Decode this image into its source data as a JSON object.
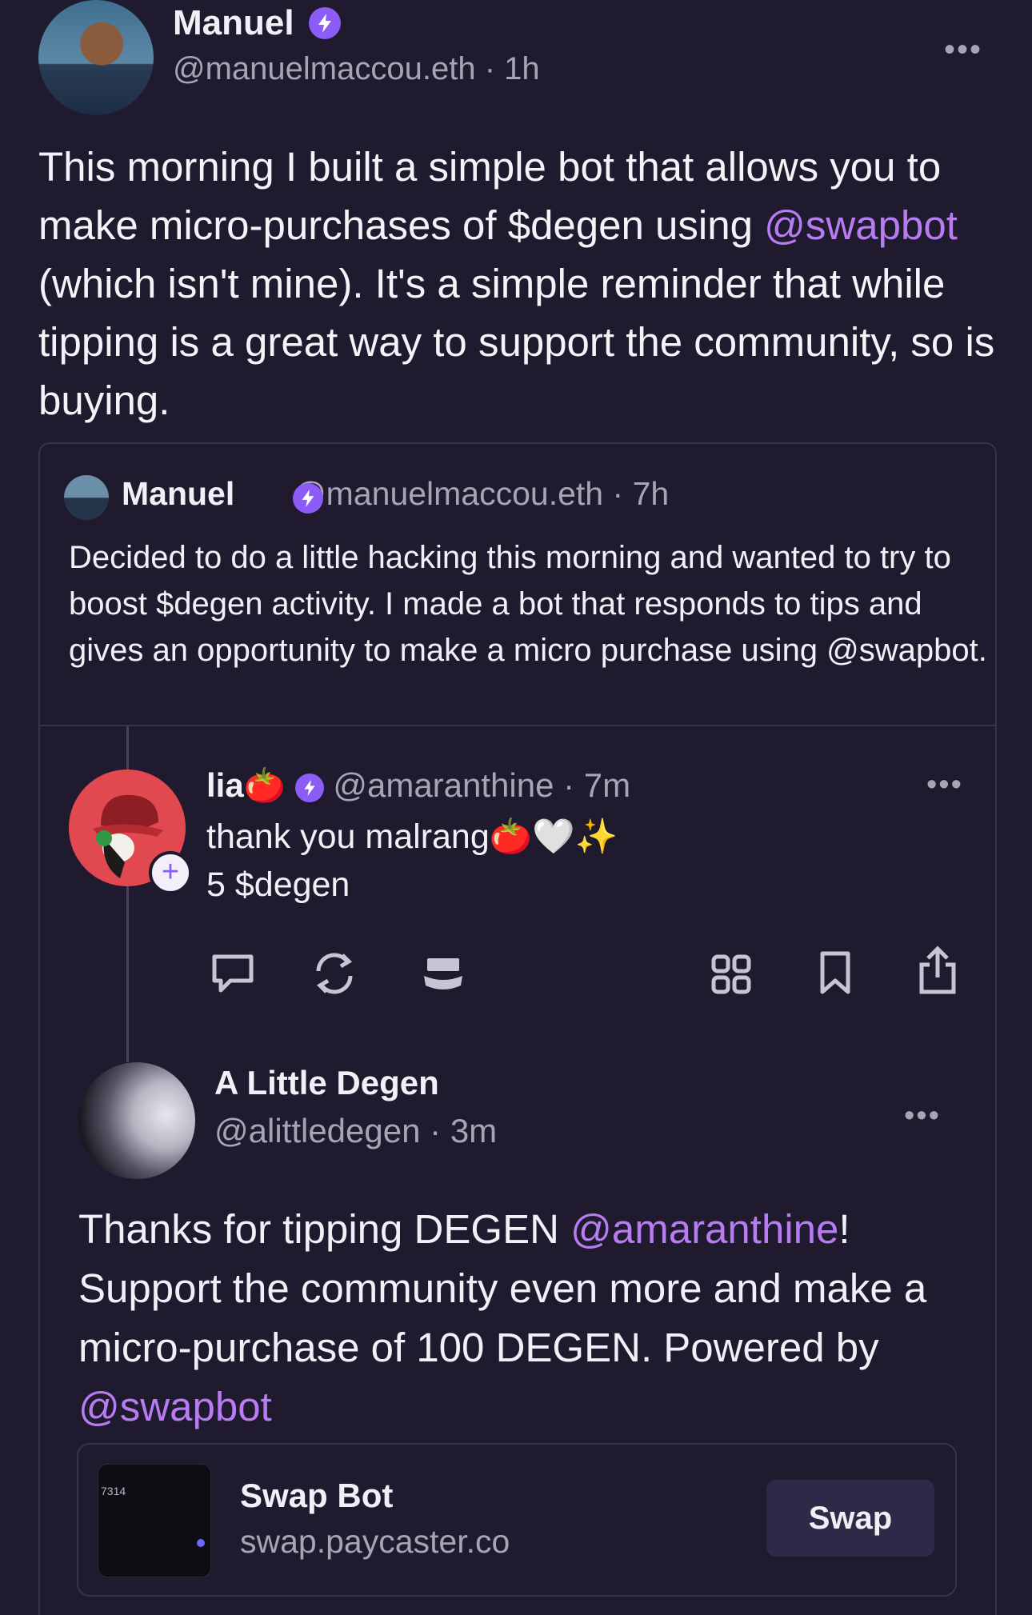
{
  "post": {
    "author_name": "Manuel",
    "author_handle": "@manuelmaccou.eth",
    "time": "1h",
    "more_icon": "ellipsis-icon",
    "body": {
      "part1": "This morning I built a simple bot that allows you to make micro-purchases of $degen using ",
      "mention": "@swapbot",
      "part2": " (which isn't mine). It's a simple reminder that while tipping is a great way to support the community, so is buying."
    }
  },
  "quote": {
    "author_name": "Manuel",
    "author_handle": "@manuelmaccou.eth",
    "time": "7h",
    "body": "Decided to do a little hacking this morning and wanted to try to boost $degen activity. I made a bot that responds to tips and gives an opportunity to make a micro purchase using @swapbot."
  },
  "reply1": {
    "author_name": "lia🍅",
    "author_handle": "@amaranthine",
    "time": "7m",
    "text_line1": "thank you malrang🍅🤍✨",
    "text_line2": "5 $degen",
    "plus": "+",
    "actions": [
      "reply-icon",
      "recast-icon",
      "hat-icon",
      "grid-icon",
      "bookmark-icon",
      "share-icon"
    ]
  },
  "reply2": {
    "author_name": "A Little Degen",
    "author_handle": "@alittledegen",
    "time": "3m",
    "text": {
      "part1": "Thanks for tipping DEGEN ",
      "mention1": "@amaranthine",
      "part2": "! Support the community even more and make a micro-purchase of 100 DEGEN. Powered by ",
      "mention2": "@swapbot"
    },
    "frame": {
      "thumb_label": "7314",
      "title": "Swap Bot",
      "domain": "swap.paycaster.co",
      "button": "Swap"
    }
  },
  "colors": {
    "background": "#201a2f",
    "accent": "#b77bf2",
    "verified": "#8b5cf6"
  }
}
